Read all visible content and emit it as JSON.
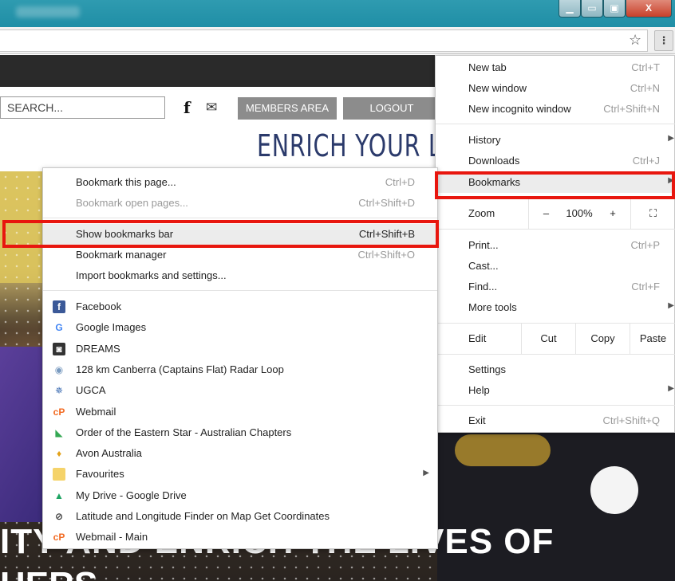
{
  "browser": {
    "window_controls": {
      "minimize": "▁",
      "maximize": "▭",
      "restore": "▣",
      "close": "X"
    },
    "omnibox_value": "",
    "star_icon": "☆",
    "menu_icon": "⋮"
  },
  "site": {
    "search_placeholder": "SEARCH...",
    "facebook_icon": "f",
    "mail_icon": "✉",
    "members_area": "MEMBERS AREA",
    "logout": "LOGOUT",
    "tagline": "ENRICH YOUR LIFE",
    "hero_caption_line1": "ITY AND ENRICH THE LIVES OF",
    "hero_caption_line2": "HERS"
  },
  "main_menu": {
    "new_tab": {
      "label": "New tab",
      "shortcut": "Ctrl+T"
    },
    "new_window": {
      "label": "New window",
      "shortcut": "Ctrl+N"
    },
    "new_incognito": {
      "label": "New incognito window",
      "shortcut": "Ctrl+Shift+N"
    },
    "history": {
      "label": "History"
    },
    "downloads": {
      "label": "Downloads",
      "shortcut": "Ctrl+J"
    },
    "bookmarks": {
      "label": "Bookmarks"
    },
    "zoom": {
      "label": "Zoom",
      "minus": "–",
      "value": "100%",
      "plus": "+",
      "fullscreen": "⛶"
    },
    "print": {
      "label": "Print...",
      "shortcut": "Ctrl+P"
    },
    "cast": {
      "label": "Cast..."
    },
    "find": {
      "label": "Find...",
      "shortcut": "Ctrl+F"
    },
    "more_tools": {
      "label": "More tools"
    },
    "edit": {
      "label": "Edit",
      "cut": "Cut",
      "copy": "Copy",
      "paste": "Paste"
    },
    "settings": {
      "label": "Settings"
    },
    "help": {
      "label": "Help"
    },
    "exit": {
      "label": "Exit",
      "shortcut": "Ctrl+Shift+Q"
    },
    "submenu_arrow": "▶"
  },
  "bookmarks_menu": {
    "bookmark_page": {
      "label": "Bookmark this page...",
      "shortcut": "Ctrl+D"
    },
    "bookmark_open_pages": {
      "label": "Bookmark open pages...",
      "shortcut": "Ctrl+Shift+D"
    },
    "show_bar": {
      "label": "Show bookmarks bar",
      "shortcut": "Ctrl+Shift+B"
    },
    "manager": {
      "label": "Bookmark manager",
      "shortcut": "Ctrl+Shift+O"
    },
    "import": {
      "label": "Import bookmarks and settings..."
    },
    "items": [
      {
        "label": "Facebook",
        "icon": "facebook-icon",
        "glyph": "f",
        "color": "#3b5998",
        "fg": "#ffffff"
      },
      {
        "label": "Google Images",
        "icon": "google-icon",
        "glyph": "G",
        "color": "#ffffff",
        "fg": "#4285f4"
      },
      {
        "label": "DREAMS",
        "icon": "camera-icon",
        "glyph": "◙",
        "color": "#333333",
        "fg": "#ffffff"
      },
      {
        "label": "128 km Canberra (Captains Flat) Radar Loop",
        "icon": "radar-icon",
        "glyph": "◉",
        "color": "#ffffff",
        "fg": "#7a9bc0"
      },
      {
        "label": "UGCA",
        "icon": "star-logo-icon",
        "glyph": "✵",
        "color": "#ffffff",
        "fg": "#3a6ab0"
      },
      {
        "label": "Webmail",
        "icon": "cpanel-icon",
        "glyph": "cP",
        "color": "#ffffff",
        "fg": "#f26a22"
      },
      {
        "label": "Order of the Eastern Star - Australian Chapters",
        "icon": "maps-icon",
        "glyph": "◣",
        "color": "#ffffff",
        "fg": "#34a853"
      },
      {
        "label": "Avon Australia",
        "icon": "avon-icon",
        "glyph": "♦",
        "color": "#ffffff",
        "fg": "#e3a21a"
      },
      {
        "label": "Favourites",
        "icon": "folder-icon",
        "glyph": "",
        "color": "#f5d36a",
        "fg": "#f5d36a",
        "submenu": true
      },
      {
        "label": "My Drive - Google Drive",
        "icon": "drive-icon",
        "glyph": "▲",
        "color": "#ffffff",
        "fg": "#1fa463"
      },
      {
        "label": "Latitude and Longitude Finder on Map Get Coordinates",
        "icon": "compass-icon",
        "glyph": "⊘",
        "color": "#ffffff",
        "fg": "#333333"
      },
      {
        "label": "Webmail - Main",
        "icon": "cpanel-icon",
        "glyph": "cP",
        "color": "#ffffff",
        "fg": "#f26a22"
      }
    ]
  },
  "colors": {
    "highlight": "#e8160e",
    "menu_hover": "#ececec"
  }
}
